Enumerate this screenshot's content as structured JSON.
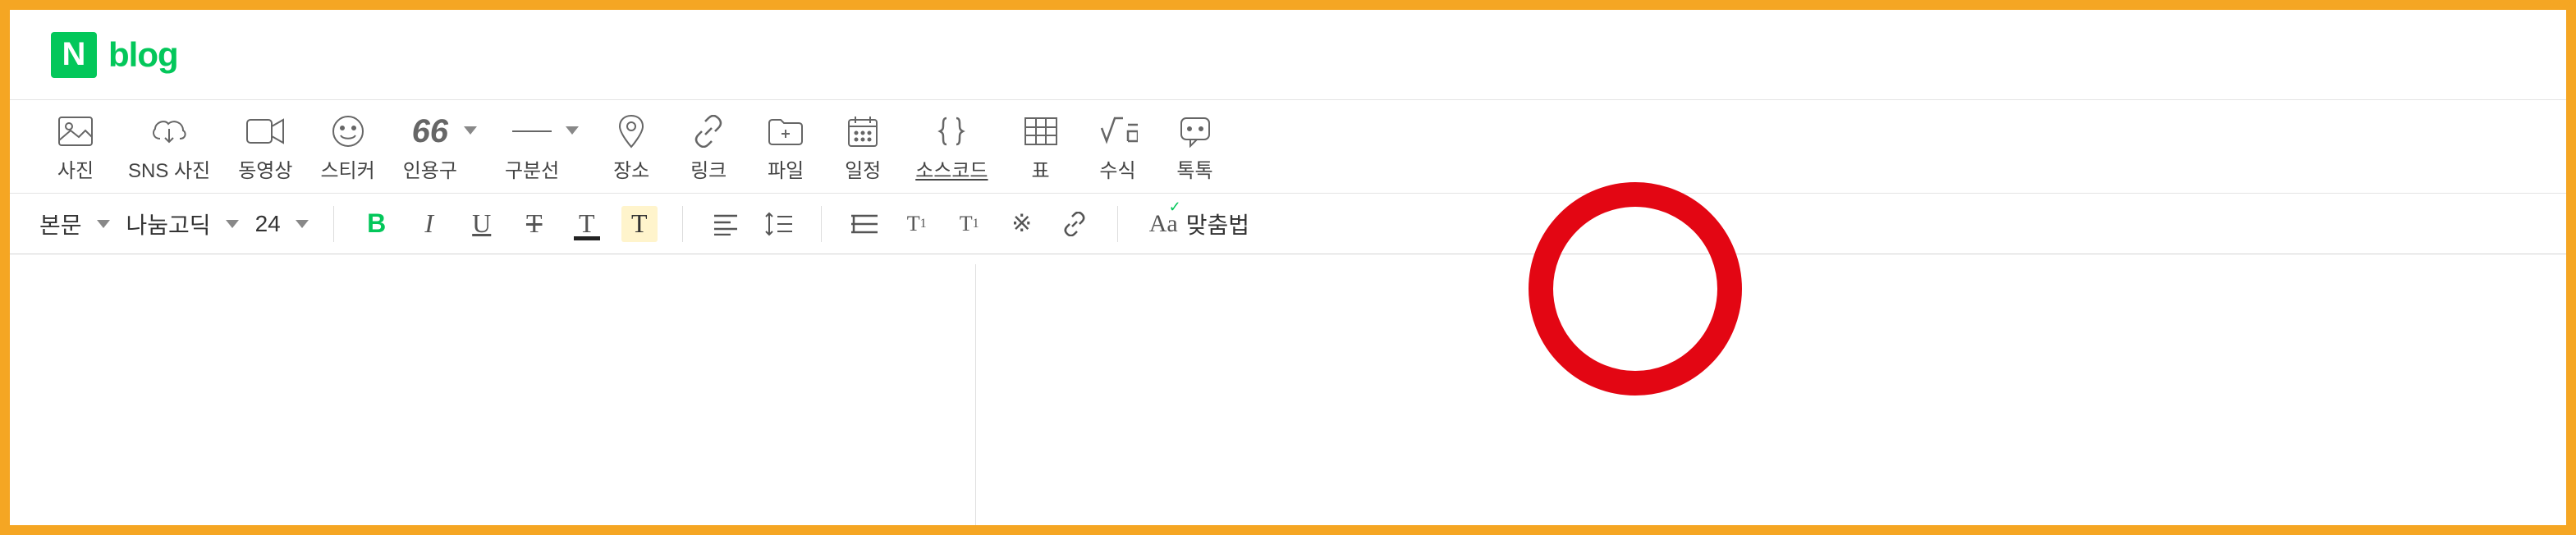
{
  "brand": {
    "letter": "N",
    "word": "blog"
  },
  "insert": {
    "photo": "사진",
    "sns_photo": "SNS 사진",
    "video": "동영상",
    "sticker": "스티커",
    "quote": "인용구",
    "divider": "구분선",
    "place": "장소",
    "link": "링크",
    "file": "파일",
    "schedule": "일정",
    "source": "소스코드",
    "table": "표",
    "formula": "수식",
    "talk": "톡톡"
  },
  "format": {
    "body_label": "본문",
    "font": "나눔고딕",
    "size": "24",
    "quote_glyph": "66",
    "spellcheck": "맞춤법"
  }
}
